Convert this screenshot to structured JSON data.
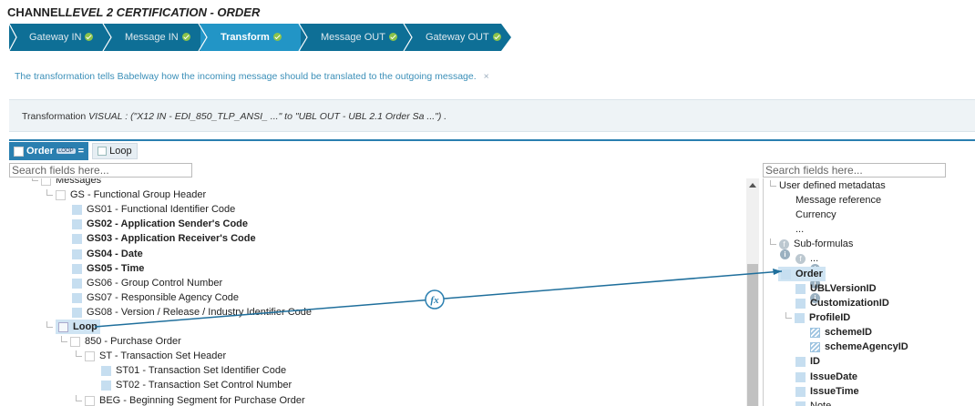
{
  "title": {
    "part1": "CHANNEL",
    "part2": "LEVEL 2 CERTIFICATION",
    "part3": " - ORDER"
  },
  "steps": [
    {
      "label": "Gateway IN",
      "done": true
    },
    {
      "label": "Message IN",
      "done": true
    },
    {
      "label": "Transform",
      "done": true,
      "active": true
    },
    {
      "label": "Message OUT",
      "done": true
    },
    {
      "label": "Gateway OUT",
      "done": true
    }
  ],
  "info_text": "The transformation tells Babelway how the incoming message should be translated to the outgoing message.",
  "info_close": "×",
  "transformation": {
    "label": "Transformation",
    "type": "VISUAL",
    "detail": " : (\"X12 IN - EDI_850_TLP_ANSI_ ...\" to \"UBL OUT - UBL 2.1 Order Sa ...\") ."
  },
  "breadcrumb": {
    "root": "Order",
    "badge": "LOOP",
    "eq": "=",
    "current": "Loop"
  },
  "search_placeholder": "Search fields here...",
  "left_tree": [
    {
      "label": "Messages"
    },
    {
      "label": "GS - Functional Group Header"
    },
    {
      "label": "GS01 - Functional Identifier Code"
    },
    {
      "label": "GS02 - Application Sender's Code"
    },
    {
      "label": "GS03 - Application Receiver's Code"
    },
    {
      "label": "GS04 - Date"
    },
    {
      "label": "GS05 - Time"
    },
    {
      "label": "GS06 - Group Control Number"
    },
    {
      "label": "GS07 - Responsible Agency Code"
    },
    {
      "label": "GS08 - Version / Release / Industry Identifier Code"
    },
    {
      "label": "Loop"
    },
    {
      "label": "850 - Purchase Order"
    },
    {
      "label": "ST - Transaction Set Header"
    },
    {
      "label": "ST01 - Transaction Set Identifier Code"
    },
    {
      "label": "ST02 - Transaction Set Control Number"
    },
    {
      "label": "BEG - Beginning Segment for Purchase Order"
    }
  ],
  "right_tree": [
    {
      "label": "User defined metadatas"
    },
    {
      "label": "Message reference"
    },
    {
      "label": "Currency"
    },
    {
      "label": "..."
    },
    {
      "label": "Sub-formulas"
    },
    {
      "label": "..."
    },
    {
      "label": "Order"
    },
    {
      "label": "UBLVersionID"
    },
    {
      "label": "CustomizationID"
    },
    {
      "label": "ProfileID"
    },
    {
      "label": "schemeID"
    },
    {
      "label": "schemeAgencyID"
    },
    {
      "label": "ID"
    },
    {
      "label": "IssueDate"
    },
    {
      "label": "IssueTime"
    },
    {
      "label": "Note"
    }
  ],
  "formula_icon": "fx",
  "colors": {
    "step": "#0e6f96",
    "step_active": "#2295c6",
    "check": "#8bc34a",
    "link": "#2a7fb0"
  }
}
